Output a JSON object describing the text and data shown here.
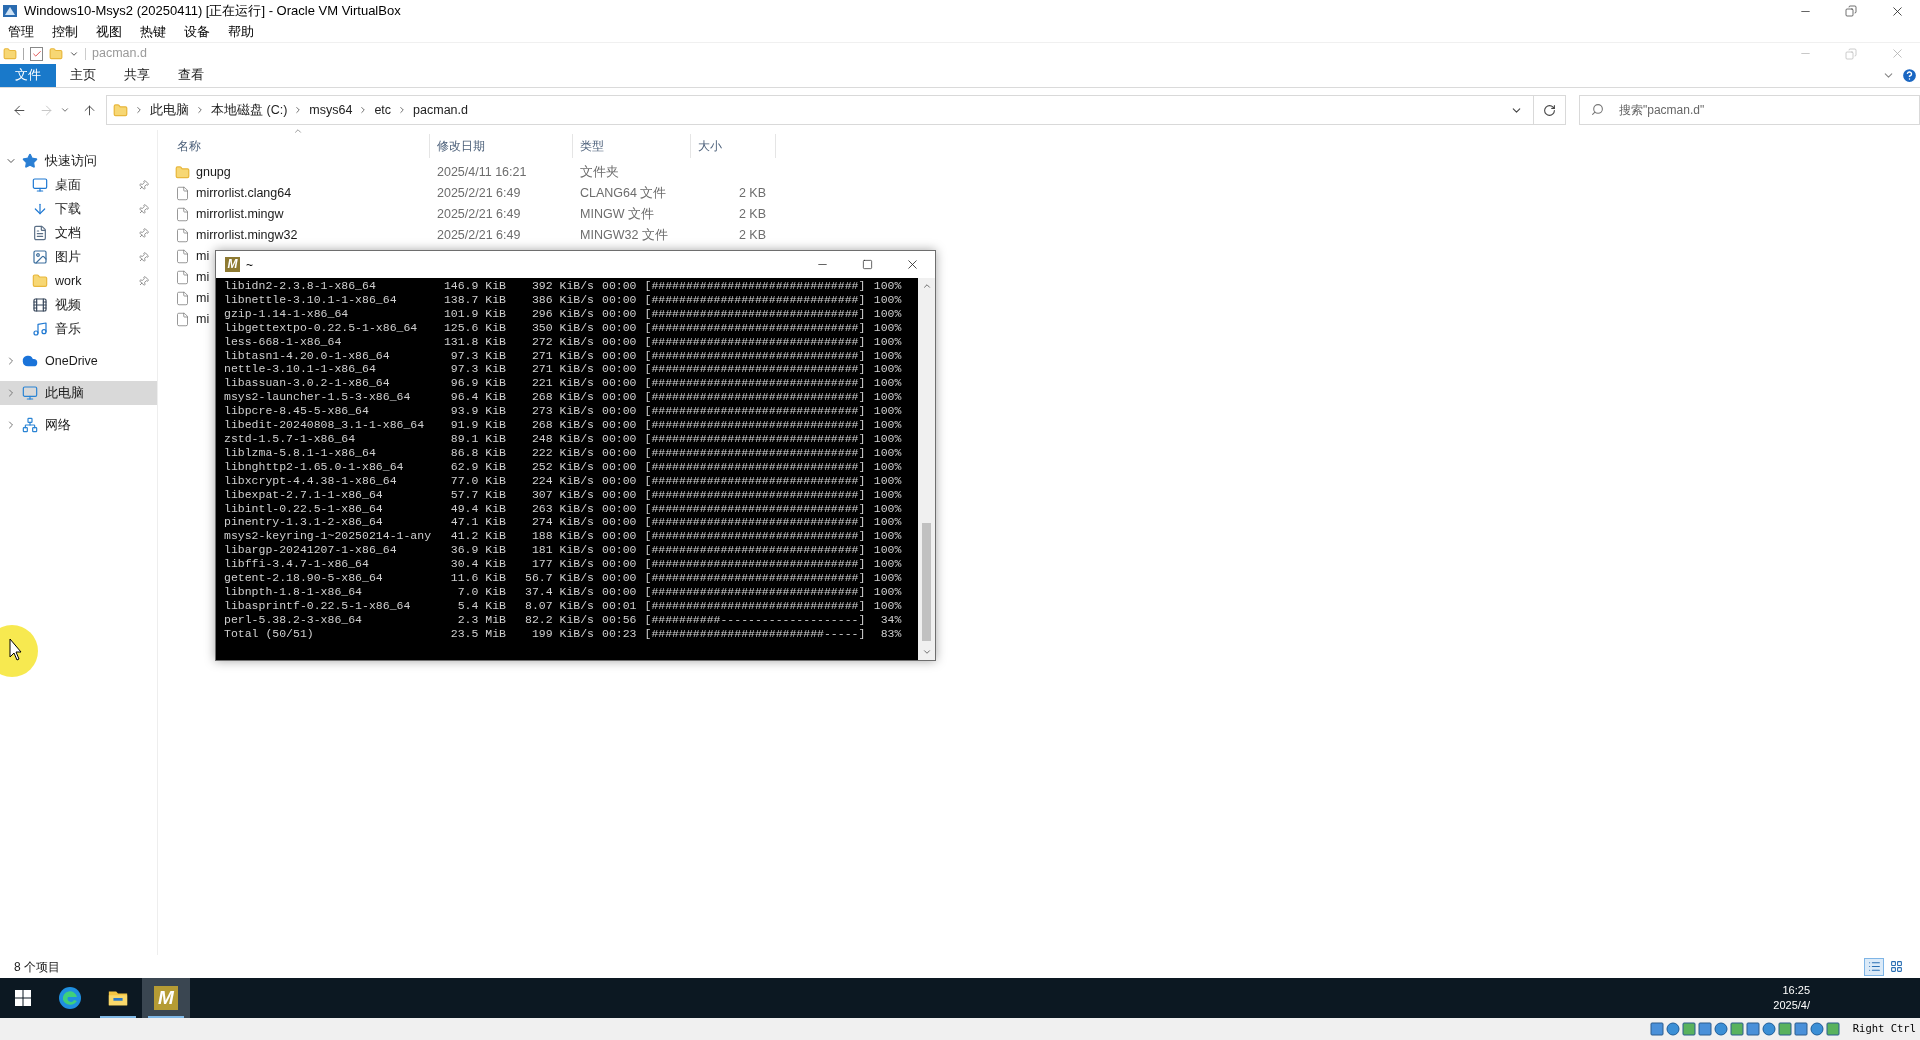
{
  "vbox": {
    "title": "Windows10-Msys2 (20250411) [正在运行] - Oracle VM VirtualBox",
    "menu": [
      "管理",
      "控制",
      "视图",
      "热键",
      "设备",
      "帮助"
    ],
    "host_key": "Right Ctrl"
  },
  "explorer": {
    "title": "pacman.d",
    "ribbon_tabs": [
      {
        "label": "文件",
        "selected": true
      },
      {
        "label": "主页",
        "selected": false
      },
      {
        "label": "共享",
        "selected": false
      },
      {
        "label": "查看",
        "selected": false
      }
    ],
    "breadcrumbs": [
      "此电脑",
      "本地磁盘 (C:)",
      "msys64",
      "etc",
      "pacman.d"
    ],
    "search": {
      "placeholder": "搜索\"pacman.d\""
    },
    "sidebar": [
      {
        "label": "快速访问",
        "kind": "star",
        "expanded": true,
        "selected": false,
        "children": [
          {
            "label": "桌面",
            "kind": "desktop",
            "pinned": true
          },
          {
            "label": "下载",
            "kind": "download",
            "pinned": true
          },
          {
            "label": "文档",
            "kind": "document",
            "pinned": true
          },
          {
            "label": "图片",
            "kind": "picture",
            "pinned": true
          },
          {
            "label": "work",
            "kind": "folder",
            "pinned": true
          },
          {
            "label": "视频",
            "kind": "video",
            "pinned": false
          },
          {
            "label": "音乐",
            "kind": "music",
            "pinned": false
          }
        ]
      },
      {
        "label": "OneDrive",
        "kind": "cloud",
        "expanded": false,
        "selected": false
      },
      {
        "label": "此电脑",
        "kind": "pc",
        "expanded": false,
        "selected": true
      },
      {
        "label": "网络",
        "kind": "network",
        "expanded": false,
        "selected": false
      }
    ],
    "columns": [
      "名称",
      "修改日期",
      "类型",
      "大小"
    ],
    "files": [
      {
        "kind": "folder",
        "name": "gnupg",
        "date": "2025/4/11 16:21",
        "type": "文件夹"
      },
      {
        "kind": "file",
        "name": "mirrorlist.clang64",
        "date": "2025/2/21 6:49",
        "type": "CLANG64 文件",
        "size": "2 KB"
      },
      {
        "kind": "file",
        "name": "mirrorlist.mingw",
        "date": "2025/2/21 6:49",
        "type": "MINGW 文件",
        "size": "2 KB"
      },
      {
        "kind": "file",
        "name": "mirrorlist.mingw32",
        "date": "2025/2/21 6:49",
        "type": "MINGW32 文件",
        "size": "2 KB"
      },
      {
        "kind": "file",
        "name": "mi"
      },
      {
        "kind": "file",
        "name": "mi"
      },
      {
        "kind": "file",
        "name": "mi"
      },
      {
        "kind": "file",
        "name": "mi"
      }
    ],
    "views": [
      {
        "kind": "details",
        "selected": true
      },
      {
        "kind": "tiles",
        "selected": false
      }
    ],
    "status": "8 个项目"
  },
  "terminal": {
    "icon_letter": "M",
    "title": "~",
    "lines": [
      {
        "name": "libidn2-2.3.8-1-x86_64",
        "size": "146.9 KiB",
        "speed": "392 KiB/s",
        "eta": "00:00",
        "bar": "[##############################]",
        "pct": "100%"
      },
      {
        "name": "libnettle-3.10.1-1-x86_64",
        "size": "138.7 KiB",
        "speed": "386 KiB/s",
        "eta": "00:00",
        "bar": "[##############################]",
        "pct": "100%"
      },
      {
        "name": "gzip-1.14-1-x86_64",
        "size": "101.9 KiB",
        "speed": "296 KiB/s",
        "eta": "00:00",
        "bar": "[##############################]",
        "pct": "100%"
      },
      {
        "name": "libgettextpo-0.22.5-1-x86_64",
        "size": "125.6 KiB",
        "speed": "350 KiB/s",
        "eta": "00:00",
        "bar": "[##############################]",
        "pct": "100%"
      },
      {
        "name": "less-668-1-x86_64",
        "size": "131.8 KiB",
        "speed": "272 KiB/s",
        "eta": "00:00",
        "bar": "[##############################]",
        "pct": "100%"
      },
      {
        "name": "libtasn1-4.20.0-1-x86_64",
        "size": "97.3 KiB",
        "speed": "271 KiB/s",
        "eta": "00:00",
        "bar": "[##############################]",
        "pct": "100%"
      },
      {
        "name": "nettle-3.10.1-1-x86_64",
        "size": "97.3 KiB",
        "speed": "271 KiB/s",
        "eta": "00:00",
        "bar": "[##############################]",
        "pct": "100%"
      },
      {
        "name": "libassuan-3.0.2-1-x86_64",
        "size": "96.9 KiB",
        "speed": "221 KiB/s",
        "eta": "00:00",
        "bar": "[##############################]",
        "pct": "100%"
      },
      {
        "name": "msys2-launcher-1.5-3-x86_64",
        "size": "96.4 KiB",
        "speed": "268 KiB/s",
        "eta": "00:00",
        "bar": "[##############################]",
        "pct": "100%"
      },
      {
        "name": "libpcre-8.45-5-x86_64",
        "size": "93.9 KiB",
        "speed": "273 KiB/s",
        "eta": "00:00",
        "bar": "[##############################]",
        "pct": "100%"
      },
      {
        "name": "libedit-20240808_3.1-1-x86_64",
        "size": "91.9 KiB",
        "speed": "268 KiB/s",
        "eta": "00:00",
        "bar": "[##############################]",
        "pct": "100%"
      },
      {
        "name": "zstd-1.5.7-1-x86_64",
        "size": "89.1 KiB",
        "speed": "248 KiB/s",
        "eta": "00:00",
        "bar": "[##############################]",
        "pct": "100%"
      },
      {
        "name": "liblzma-5.8.1-1-x86_64",
        "size": "86.8 KiB",
        "speed": "222 KiB/s",
        "eta": "00:00",
        "bar": "[##############################]",
        "pct": "100%"
      },
      {
        "name": "libnghttp2-1.65.0-1-x86_64",
        "size": "62.9 KiB",
        "speed": "252 KiB/s",
        "eta": "00:00",
        "bar": "[##############################]",
        "pct": "100%"
      },
      {
        "name": "libxcrypt-4.4.38-1-x86_64",
        "size": "77.0 KiB",
        "speed": "224 KiB/s",
        "eta": "00:00",
        "bar": "[##############################]",
        "pct": "100%"
      },
      {
        "name": "libexpat-2.7.1-1-x86_64",
        "size": "57.7 KiB",
        "speed": "307 KiB/s",
        "eta": "00:00",
        "bar": "[##############################]",
        "pct": "100%"
      },
      {
        "name": "libintl-0.22.5-1-x86_64",
        "size": "49.4 KiB",
        "speed": "263 KiB/s",
        "eta": "00:00",
        "bar": "[##############################]",
        "pct": "100%"
      },
      {
        "name": "pinentry-1.3.1-2-x86_64",
        "size": "47.1 KiB",
        "speed": "274 KiB/s",
        "eta": "00:00",
        "bar": "[##############################]",
        "pct": "100%"
      },
      {
        "name": "msys2-keyring-1~20250214-1-any",
        "size": "41.2 KiB",
        "speed": "188 KiB/s",
        "eta": "00:00",
        "bar": "[##############################]",
        "pct": "100%"
      },
      {
        "name": "libargp-20241207-1-x86_64",
        "size": "36.9 KiB",
        "speed": "181 KiB/s",
        "eta": "00:00",
        "bar": "[##############################]",
        "pct": "100%"
      },
      {
        "name": "libffi-3.4.7-1-x86_64",
        "size": "30.4 KiB",
        "speed": "177 KiB/s",
        "eta": "00:00",
        "bar": "[##############################]",
        "pct": "100%"
      },
      {
        "name": "getent-2.18.90-5-x86_64",
        "size": "11.6 KiB",
        "speed": "56.7 KiB/s",
        "eta": "00:00",
        "bar": "[##############################]",
        "pct": "100%"
      },
      {
        "name": "libnpth-1.8-1-x86_64",
        "size": "7.0 KiB",
        "speed": "37.4 KiB/s",
        "eta": "00:00",
        "bar": "[##############################]",
        "pct": "100%"
      },
      {
        "name": "libasprintf-0.22.5-1-x86_64",
        "size": "5.4 KiB",
        "speed": "8.07 KiB/s",
        "eta": "00:01",
        "bar": "[##############################]",
        "pct": "100%"
      },
      {
        "name": "perl-5.38.2-3-x86_64",
        "size": "2.3 MiB",
        "speed": "82.2 KiB/s",
        "eta": "00:56",
        "bar": "[##########--------------------]",
        "pct": "34%"
      },
      {
        "name": "Total (50/51)",
        "size": "23.5 MiB",
        "speed": "199 KiB/s",
        "eta": "00:23",
        "bar": "[#########################-----]",
        "pct": "83%"
      }
    ]
  },
  "taskbar": {
    "apps": [
      {
        "kind": "edge",
        "running": false,
        "selected": false
      },
      {
        "kind": "explorer",
        "running": true,
        "selected": false
      },
      {
        "kind": "msys",
        "letter": "M",
        "running": true,
        "selected": true
      }
    ],
    "clock": {
      "time": "16:25",
      "date": "2025/4/"
    }
  }
}
